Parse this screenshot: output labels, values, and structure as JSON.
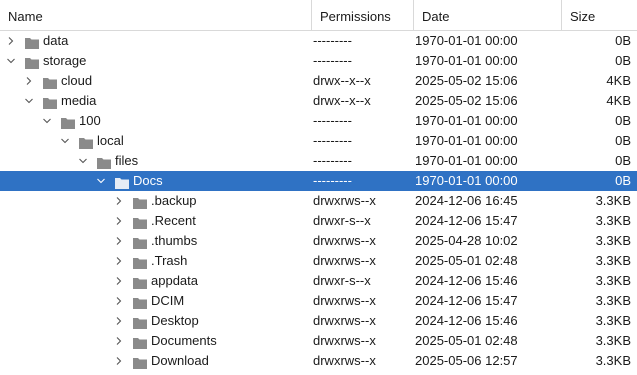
{
  "columns": {
    "name": "Name",
    "permissions": "Permissions",
    "date": "Date",
    "size": "Size"
  },
  "colors": {
    "selected_bg": "#2f72c4",
    "folder": "#8a8a8a",
    "folder_selected": "#e6ecf5",
    "arrow": "#555555"
  },
  "rows": [
    {
      "name": "data",
      "depth": 0,
      "expanded": false,
      "permissions": "---------",
      "date": "1970-01-01 00:00",
      "size": "0B",
      "selected": false
    },
    {
      "name": "storage",
      "depth": 0,
      "expanded": true,
      "permissions": "---------",
      "date": "1970-01-01 00:00",
      "size": "0B",
      "selected": false
    },
    {
      "name": "cloud",
      "depth": 1,
      "expanded": false,
      "permissions": "drwx--x--x",
      "date": "2025-05-02 15:06",
      "size": "4KB",
      "selected": false
    },
    {
      "name": "media",
      "depth": 1,
      "expanded": true,
      "permissions": "drwx--x--x",
      "date": "2025-05-02 15:06",
      "size": "4KB",
      "selected": false
    },
    {
      "name": "100",
      "depth": 2,
      "expanded": true,
      "permissions": "---------",
      "date": "1970-01-01 00:00",
      "size": "0B",
      "selected": false
    },
    {
      "name": "local",
      "depth": 3,
      "expanded": true,
      "permissions": "---------",
      "date": "1970-01-01 00:00",
      "size": "0B",
      "selected": false
    },
    {
      "name": "files",
      "depth": 4,
      "expanded": true,
      "permissions": "---------",
      "date": "1970-01-01 00:00",
      "size": "0B",
      "selected": false
    },
    {
      "name": "Docs",
      "depth": 5,
      "expanded": true,
      "permissions": "---------",
      "date": "1970-01-01 00:00",
      "size": "0B",
      "selected": true
    },
    {
      "name": ".backup",
      "depth": 6,
      "expanded": false,
      "permissions": "drwxrws--x",
      "date": "2024-12-06 16:45",
      "size": "3.3KB",
      "selected": false
    },
    {
      "name": ".Recent",
      "depth": 6,
      "expanded": false,
      "permissions": "drwxr-s--x",
      "date": "2024-12-06 15:47",
      "size": "3.3KB",
      "selected": false
    },
    {
      "name": ".thumbs",
      "depth": 6,
      "expanded": false,
      "permissions": "drwxrws--x",
      "date": "2025-04-28 10:02",
      "size": "3.3KB",
      "selected": false
    },
    {
      "name": ".Trash",
      "depth": 6,
      "expanded": false,
      "permissions": "drwxrws--x",
      "date": "2025-05-01 02:48",
      "size": "3.3KB",
      "selected": false
    },
    {
      "name": "appdata",
      "depth": 6,
      "expanded": false,
      "permissions": "drwxr-s--x",
      "date": "2024-12-06 15:46",
      "size": "3.3KB",
      "selected": false
    },
    {
      "name": "DCIM",
      "depth": 6,
      "expanded": false,
      "permissions": "drwxrws--x",
      "date": "2024-12-06 15:47",
      "size": "3.3KB",
      "selected": false
    },
    {
      "name": "Desktop",
      "depth": 6,
      "expanded": false,
      "permissions": "drwxrws--x",
      "date": "2024-12-06 15:46",
      "size": "3.3KB",
      "selected": false
    },
    {
      "name": "Documents",
      "depth": 6,
      "expanded": false,
      "permissions": "drwxrws--x",
      "date": "2025-05-01 02:48",
      "size": "3.3KB",
      "selected": false
    },
    {
      "name": "Download",
      "depth": 6,
      "expanded": false,
      "permissions": "drwxrws--x",
      "date": "2025-05-06 12:57",
      "size": "3.3KB",
      "selected": false
    }
  ]
}
